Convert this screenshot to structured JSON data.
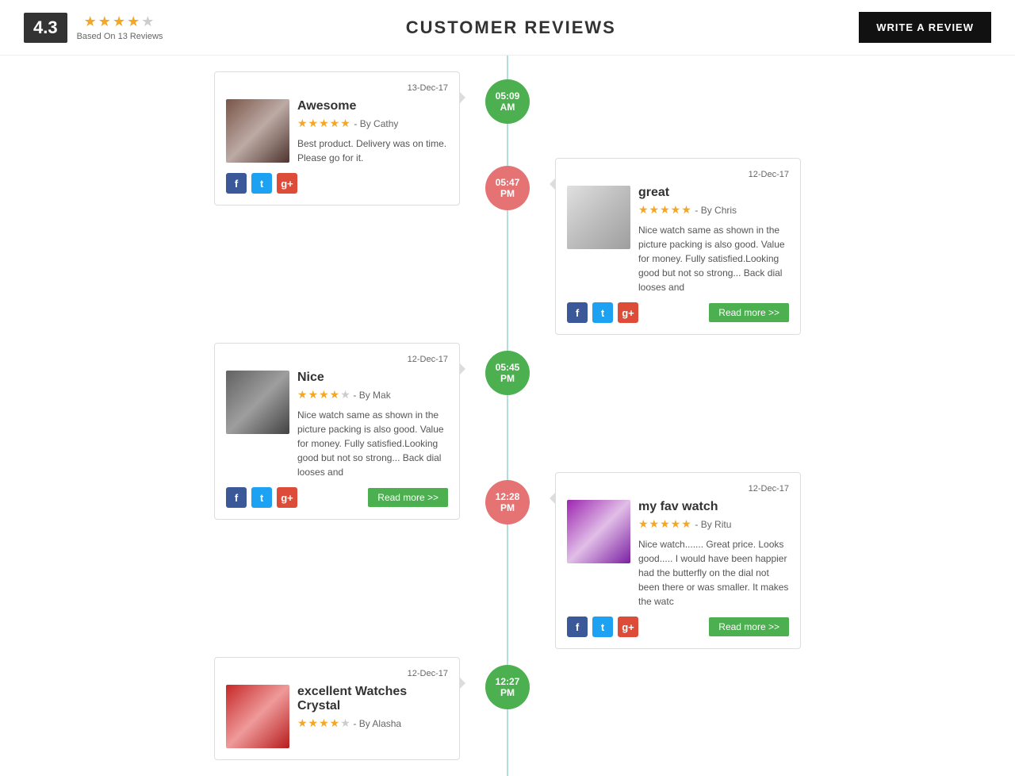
{
  "header": {
    "rating_number": "4.3",
    "stars_full": 4,
    "stars_total": 5,
    "based_on": "Based On 13 Reviews",
    "title": "CUSTOMER REVIEWS",
    "write_review_btn": "WRITE A REVIEW"
  },
  "reviews": [
    {
      "id": "r1",
      "side": "left",
      "date": "13-Dec-17",
      "time": "05:09",
      "period": "AM",
      "bubble_color": "green",
      "title": "Awesome",
      "stars": 5,
      "author": "- By Cathy",
      "text": "Best product. Delivery was on time. Please go for it.",
      "has_read_more": false,
      "img_class": "watch-img-1"
    },
    {
      "id": "r2",
      "side": "right",
      "date": "12-Dec-17",
      "time": "05:47",
      "period": "PM",
      "bubble_color": "red",
      "title": "great",
      "stars": 5,
      "author": "- By Chris",
      "text": "Nice watch same as shown in the picture packing is also good. Value for money. Fully satisfied.Looking good but not so strong... Back dial looses and",
      "has_read_more": true,
      "img_class": "watch-img-2"
    },
    {
      "id": "r3",
      "side": "left",
      "date": "12-Dec-17",
      "time": "05:45",
      "period": "PM",
      "bubble_color": "green",
      "title": "Nice",
      "stars": 4,
      "author": "- By Mak",
      "text": "Nice watch same as shown in the picture packing is also good. Value for money. Fully satisfied.Looking good but not so strong... Back dial looses and",
      "has_read_more": true,
      "img_class": "watch-img-3"
    },
    {
      "id": "r4",
      "side": "right",
      "date": "12-Dec-17",
      "time": "12:28",
      "period": "PM",
      "bubble_color": "red",
      "title": "my fav watch",
      "stars": 5,
      "author": "- By Ritu",
      "text": "Nice watch....... Great price. Looks good..... I would have been happier had the butterfly on the dial not been there or was smaller. It makes the watc",
      "has_read_more": true,
      "img_class": "watch-img-4"
    },
    {
      "id": "r5",
      "side": "left",
      "date": "12-Dec-17",
      "time": "12:27",
      "period": "PM",
      "bubble_color": "green",
      "title": "excellent Watches Crystal",
      "stars": 4,
      "author": "- By Alasha",
      "text": "",
      "has_read_more": false,
      "img_class": "watch-img-5"
    }
  ],
  "social": {
    "fb_label": "f",
    "tw_label": "t",
    "gp_label": "g+"
  },
  "read_more_label": "Read more >>"
}
